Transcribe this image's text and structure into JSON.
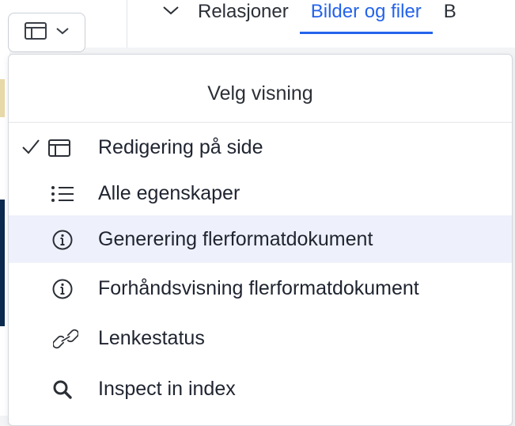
{
  "header": {
    "tabs": [
      {
        "label": "Relasjoner"
      },
      {
        "label": "Bilder og filer"
      },
      {
        "label": "B"
      }
    ],
    "active_tab_color": "#2563eb"
  },
  "menu": {
    "title": "Velg visning",
    "items": [
      {
        "label": "Redigering på side",
        "icon": "layout-icon",
        "checked": true
      },
      {
        "label": "Alle egenskaper",
        "icon": "list-icon",
        "checked": false
      },
      {
        "label": "Generering flerformatdokument",
        "icon": "info-icon",
        "checked": false,
        "highlighted": true
      },
      {
        "label": "Forhåndsvisning flerformatdokument",
        "icon": "info-icon",
        "checked": false
      },
      {
        "label": "Lenkestatus",
        "icon": "link-icon",
        "checked": false
      },
      {
        "label": "Inspect in index",
        "icon": "search-icon",
        "checked": false
      }
    ],
    "highlight_color": "#eef1fb"
  }
}
